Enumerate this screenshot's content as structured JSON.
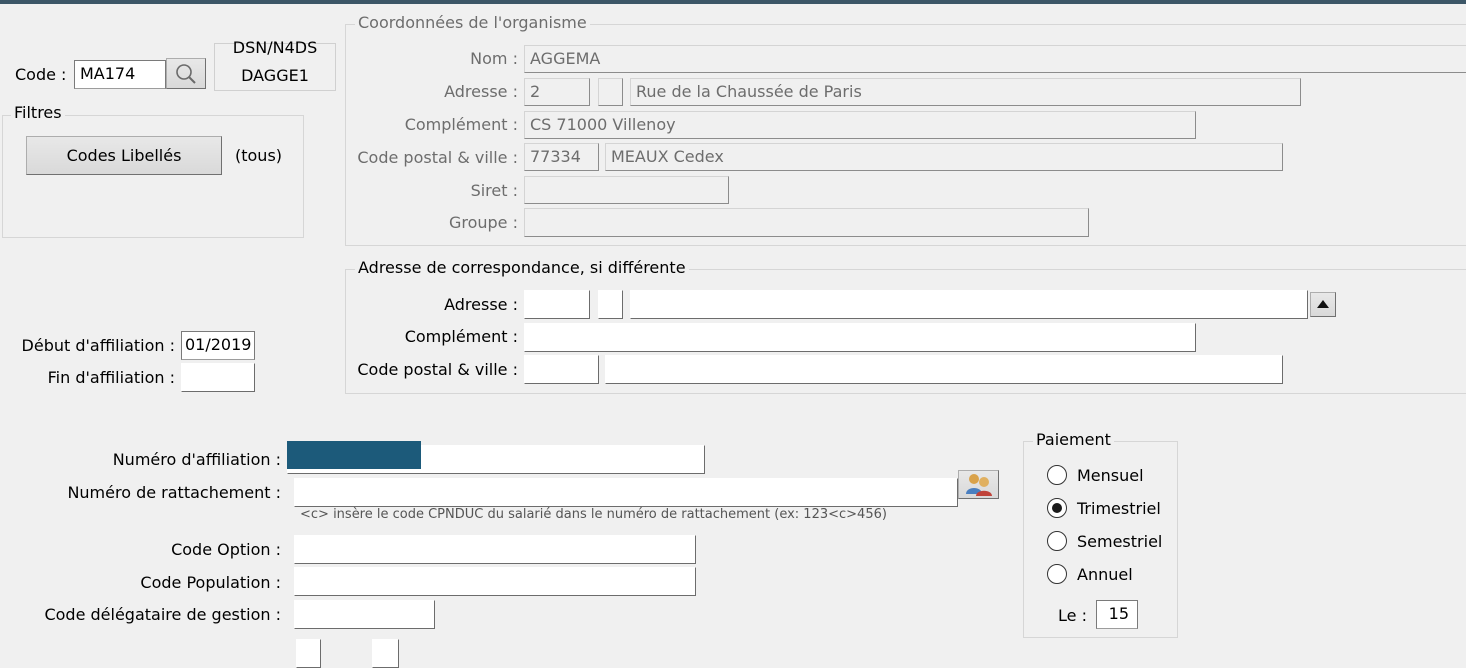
{
  "code": {
    "label": "Code :",
    "value": "MA174"
  },
  "dsn": {
    "title": "DSN/N4DS",
    "value": "DAGGE1"
  },
  "filtres": {
    "legend": "Filtres",
    "button_label": "Codes Libellés",
    "status": "(tous)"
  },
  "organisme": {
    "legend": "Coordonnées de l'organisme",
    "nom_label": "Nom :",
    "nom": "AGGEMA",
    "adresse_label": "Adresse :",
    "adresse_num": "2",
    "adresse_ext": "",
    "adresse_voie": "Rue de la Chaussée de Paris",
    "complement_label": "Complément :",
    "complement": "CS 71000 Villenoy",
    "cp_label": "Code postal & ville :",
    "cp": "77334",
    "ville": "MEAUX Cedex",
    "siret_label": "Siret :",
    "siret": "",
    "groupe_label": "Groupe :",
    "groupe": ""
  },
  "correspondance": {
    "legend": "Adresse de correspondance, si différente",
    "adresse_label": "Adresse :",
    "adresse_num": "",
    "adresse_ext": "",
    "adresse_voie": "",
    "complement_label": "Complément :",
    "complement": "",
    "cp_label": "Code postal & ville :",
    "cp": "",
    "ville": ""
  },
  "affiliation": {
    "debut_label": "Début d'affiliation :",
    "debut": "01/2019",
    "fin_label": "Fin d'affiliation :",
    "fin": ""
  },
  "numeros": {
    "affiliation_label": "Numéro d'affiliation :",
    "affiliation": "",
    "rattachement_label": "Numéro de rattachement :",
    "rattachement": "",
    "hint": "<c> insère le code CPNDUC du salarié dans le numéro de rattachement (ex: 123<c>456)"
  },
  "codes": {
    "option_label": "Code Option :",
    "option": "",
    "population_label": "Code Population :",
    "population": "",
    "delegataire_label": "Code délégataire de gestion :",
    "delegataire": ""
  },
  "paiement": {
    "legend": "Paiement",
    "options": [
      "Mensuel",
      "Trimestriel",
      "Semestriel",
      "Annuel"
    ],
    "selected": "Trimestriel",
    "le_label": "Le :",
    "le": "15"
  },
  "icons": {
    "search": "search-icon",
    "users": "users-icon",
    "scroll_up": "scroll-up-icon"
  },
  "colors": {
    "topbar": "#3c5667",
    "redaction": "#1c5a7a"
  }
}
